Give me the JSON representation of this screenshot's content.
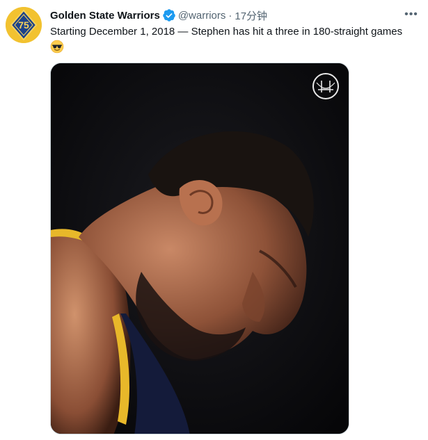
{
  "tweet": {
    "display_name": "Golden State Warriors",
    "handle": "@warriors",
    "separator": "·",
    "time": "17分钟",
    "text": "Starting December 1, 2018 — Stephen has hit a three in 180-straight games",
    "emoji": "sunglasses-emoji",
    "more_label": "•••"
  },
  "icons": {
    "avatar": "warriors-75-logo",
    "verified": "verified-badge-icon",
    "media_logo": "warriors-bridge-logo"
  },
  "colors": {
    "verified_blue": "#1d9bf0",
    "warriors_gold": "#f0c330",
    "warriors_blue": "#1d428a",
    "secondary_text": "#536471"
  }
}
